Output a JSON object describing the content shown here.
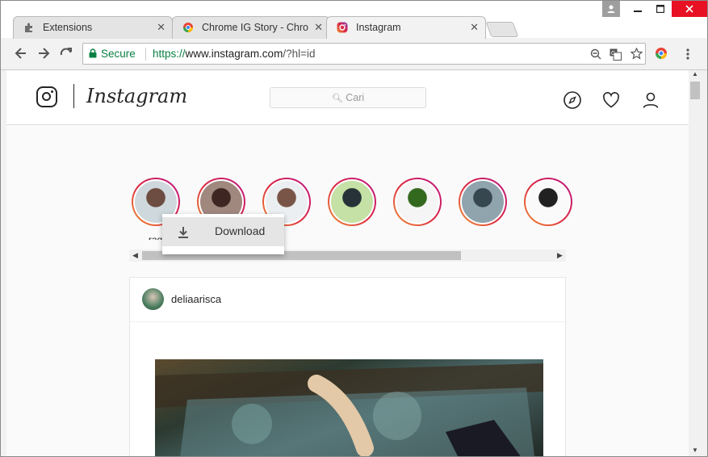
{
  "browser": {
    "tabs": [
      {
        "label": "Extensions",
        "icon": "puzzle-icon",
        "active": false
      },
      {
        "label": "Chrome IG Story - Chron",
        "icon": "chrome-ig-story-icon",
        "active": false
      },
      {
        "label": "Instagram",
        "icon": "instagram-icon",
        "active": true
      }
    ],
    "tab_close": "✕",
    "omnibox": {
      "secure_label": "Secure",
      "url_scheme": "https://",
      "url_host": "www.instagram.com",
      "url_path": "/?hl=id"
    }
  },
  "instagram": {
    "wordmark": "Instagram",
    "search_placeholder": "Cari",
    "stories": [
      {
        "username": "raq",
        "colors": [
          "#cfd8dc",
          "#6d4c41"
        ]
      },
      {
        "username": "",
        "colors": [
          "#a1887f",
          "#3e2723"
        ]
      },
      {
        "username": "",
        "colors": [
          "#eceff1",
          "#795548"
        ]
      },
      {
        "username": "",
        "colors": [
          "#c5e1a5",
          "#263238"
        ]
      },
      {
        "username": "",
        "colors": [
          "#f5f5f5",
          "#33691e"
        ]
      },
      {
        "username": "",
        "colors": [
          "#90a4ae",
          "#37474f"
        ]
      },
      {
        "username": "",
        "colors": [
          "#fafafa",
          "#212121"
        ]
      }
    ],
    "context_menu": {
      "download_label": "Download"
    },
    "post": {
      "username": "deliaarisca"
    }
  },
  "colors": {
    "secure_green": "#0b8043",
    "story_ring": "#bc1888",
    "ig_text": "#262626"
  }
}
